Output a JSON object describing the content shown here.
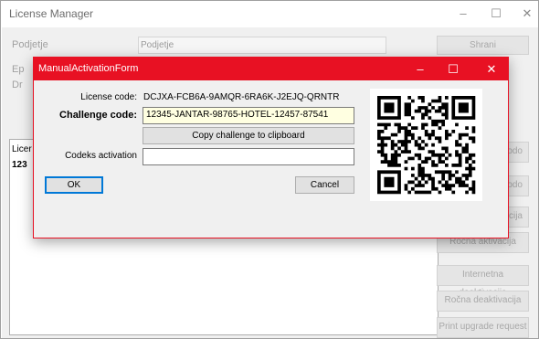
{
  "window": {
    "title": "License Manager",
    "controls": {
      "minimize": "–",
      "maximize": "☐",
      "close": "✕"
    },
    "field1_label": "Podjetje",
    "field1_value": "Podjetje",
    "field2_label_partial": "Ep",
    "field3_label_partial": "Dr",
    "save_button": "Shrani",
    "list_header_partial": "Licer",
    "list_value_partial": "123",
    "side_buttons": [
      {
        "label": "kodo"
      },
      {
        "label": "kodo"
      },
      {
        "label": "vacija"
      },
      {
        "label": "Ročna aktivacija"
      },
      {
        "label": "Internetna deaktivacija"
      },
      {
        "label": "Ročna deaktivacija"
      },
      {
        "label": "Print upgrade request"
      }
    ]
  },
  "dialog": {
    "title": "ManualActivationForm",
    "title_bar_color": "#e81123",
    "controls": {
      "minimize": "–",
      "maximize": "☐",
      "close": "✕"
    },
    "license_code_label": "License code:",
    "license_code_value": "DCJXA-FCB6A-9AMQR-6RA6K-J2EJQ-QRNTR",
    "challenge_code_label": "Challenge code:",
    "challenge_code_value": "12345-JANTAR-98765-HOTEL-12457-87541",
    "copy_button": "Copy challenge to clipboard",
    "activation_label": "Codeks activation",
    "activation_value": "",
    "ok_button": "OK",
    "cancel_button": "Cancel",
    "qr_icon": "qr-code-icon"
  }
}
